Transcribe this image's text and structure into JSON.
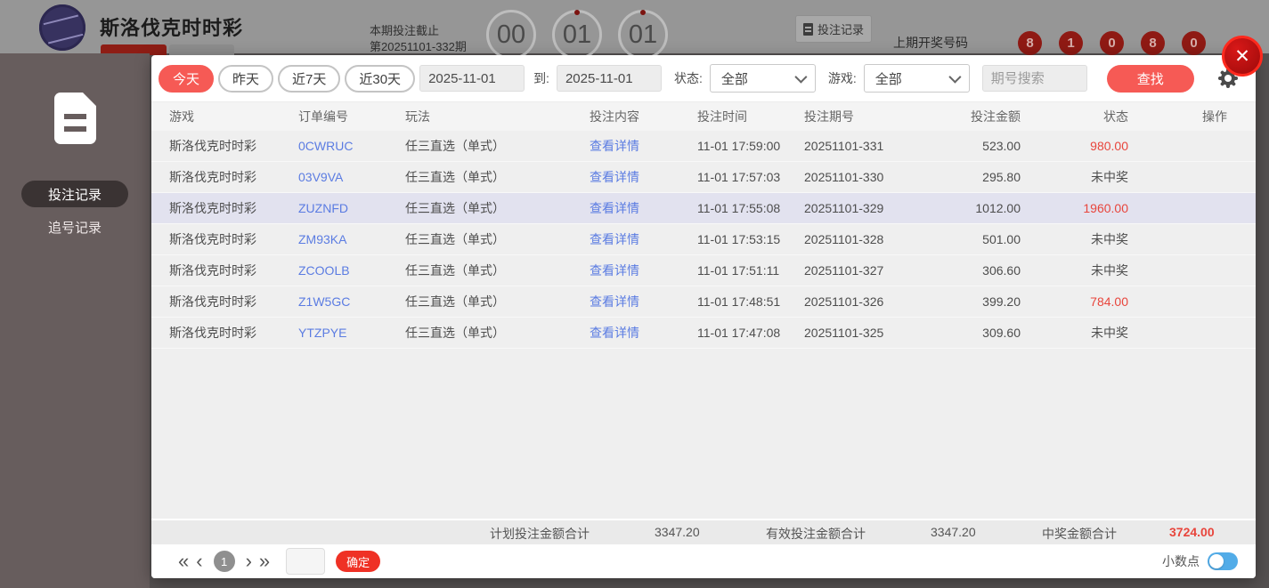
{
  "page": {
    "header": {
      "title": "斯洛伐克时时彩",
      "cutoff_line1": "本期投注截止",
      "cutoff_line2": "第20251101-332期",
      "countdown": [
        {
          "value": "00",
          "dot": false
        },
        {
          "value": "01",
          "dot": true
        },
        {
          "value": "01",
          "dot": true
        }
      ],
      "bet_records_button": "投注记录",
      "last_draw_label": "上期开奖号码",
      "last_draw_numbers": [
        "8",
        "1",
        "0",
        "8",
        "0"
      ]
    },
    "sidebar": {
      "items": [
        {
          "label": "投注记录",
          "active": true
        },
        {
          "label": "追号记录",
          "active": false
        }
      ]
    }
  },
  "modal": {
    "close_icon": "✕",
    "filters": {
      "quick_ranges": [
        {
          "label": "今天",
          "active": true
        },
        {
          "label": "昨天",
          "active": false
        },
        {
          "label": "近7天",
          "active": false
        },
        {
          "label": "近30天",
          "active": false
        }
      ],
      "date_from": "2025-11-01",
      "to_label": "到:",
      "date_to": "2025-11-01",
      "status_label": "状态:",
      "status_value": "全部",
      "game_label": "游戏:",
      "game_value": "全部",
      "search_placeholder": "期号搜索",
      "search_button": "查找"
    },
    "table": {
      "columns": [
        "游戏",
        "订单编号",
        "玩法",
        "投注内容",
        "投注时间",
        "投注期号",
        "投注金额",
        "状态",
        "操作"
      ],
      "rows": [
        {
          "game": "斯洛伐克时时彩",
          "order_id": "0CWRUC",
          "play": "任三直选（单式）",
          "content": "查看详情",
          "time": "11-01 17:59:00",
          "period": "20251101-331",
          "amount": "523.00",
          "status": "980.00",
          "win": true,
          "highlighted": false
        },
        {
          "game": "斯洛伐克时时彩",
          "order_id": "03V9VA",
          "play": "任三直选（单式）",
          "content": "查看详情",
          "time": "11-01 17:57:03",
          "period": "20251101-330",
          "amount": "295.80",
          "status": "未中奖",
          "win": false,
          "highlighted": false
        },
        {
          "game": "斯洛伐克时时彩",
          "order_id": "ZUZNFD",
          "play": "任三直选（单式）",
          "content": "查看详情",
          "time": "11-01 17:55:08",
          "period": "20251101-329",
          "amount": "1012.00",
          "status": "1960.00",
          "win": true,
          "highlighted": true
        },
        {
          "game": "斯洛伐克时时彩",
          "order_id": "ZM93KA",
          "play": "任三直选（单式）",
          "content": "查看详情",
          "time": "11-01 17:53:15",
          "period": "20251101-328",
          "amount": "501.00",
          "status": "未中奖",
          "win": false,
          "highlighted": false
        },
        {
          "game": "斯洛伐克时时彩",
          "order_id": "ZCOOLB",
          "play": "任三直选（单式）",
          "content": "查看详情",
          "time": "11-01 17:51:11",
          "period": "20251101-327",
          "amount": "306.60",
          "status": "未中奖",
          "win": false,
          "highlighted": false
        },
        {
          "game": "斯洛伐克时时彩",
          "order_id": "Z1W5GC",
          "play": "任三直选（单式）",
          "content": "查看详情",
          "time": "11-01 17:48:51",
          "period": "20251101-326",
          "amount": "399.20",
          "status": "784.00",
          "win": true,
          "highlighted": false
        },
        {
          "game": "斯洛伐克时时彩",
          "order_id": "YTZPYE",
          "play": "任三直选（单式）",
          "content": "查看详情",
          "time": "11-01 17:47:08",
          "period": "20251101-325",
          "amount": "309.60",
          "status": "未中奖",
          "win": false,
          "highlighted": false
        }
      ]
    },
    "totals": {
      "planned_label": "计划投注金额合计",
      "planned_value": "3347.20",
      "valid_label": "有效投注金额合计",
      "valid_value": "3347.20",
      "win_label": "中奖金额合计",
      "win_value": "3724.00"
    },
    "pagination": {
      "first_icon": "«",
      "prev_icon": "‹",
      "current_page": "1",
      "next_icon": "›",
      "last_icon": "»",
      "confirm_button": "确定",
      "decimal_label": "小数点"
    },
    "colors": {
      "accent_red": "#f65a55",
      "link_blue": "#5b7ce2",
      "win_red": "#e8453c",
      "toggle_blue": "#52ace8"
    }
  }
}
